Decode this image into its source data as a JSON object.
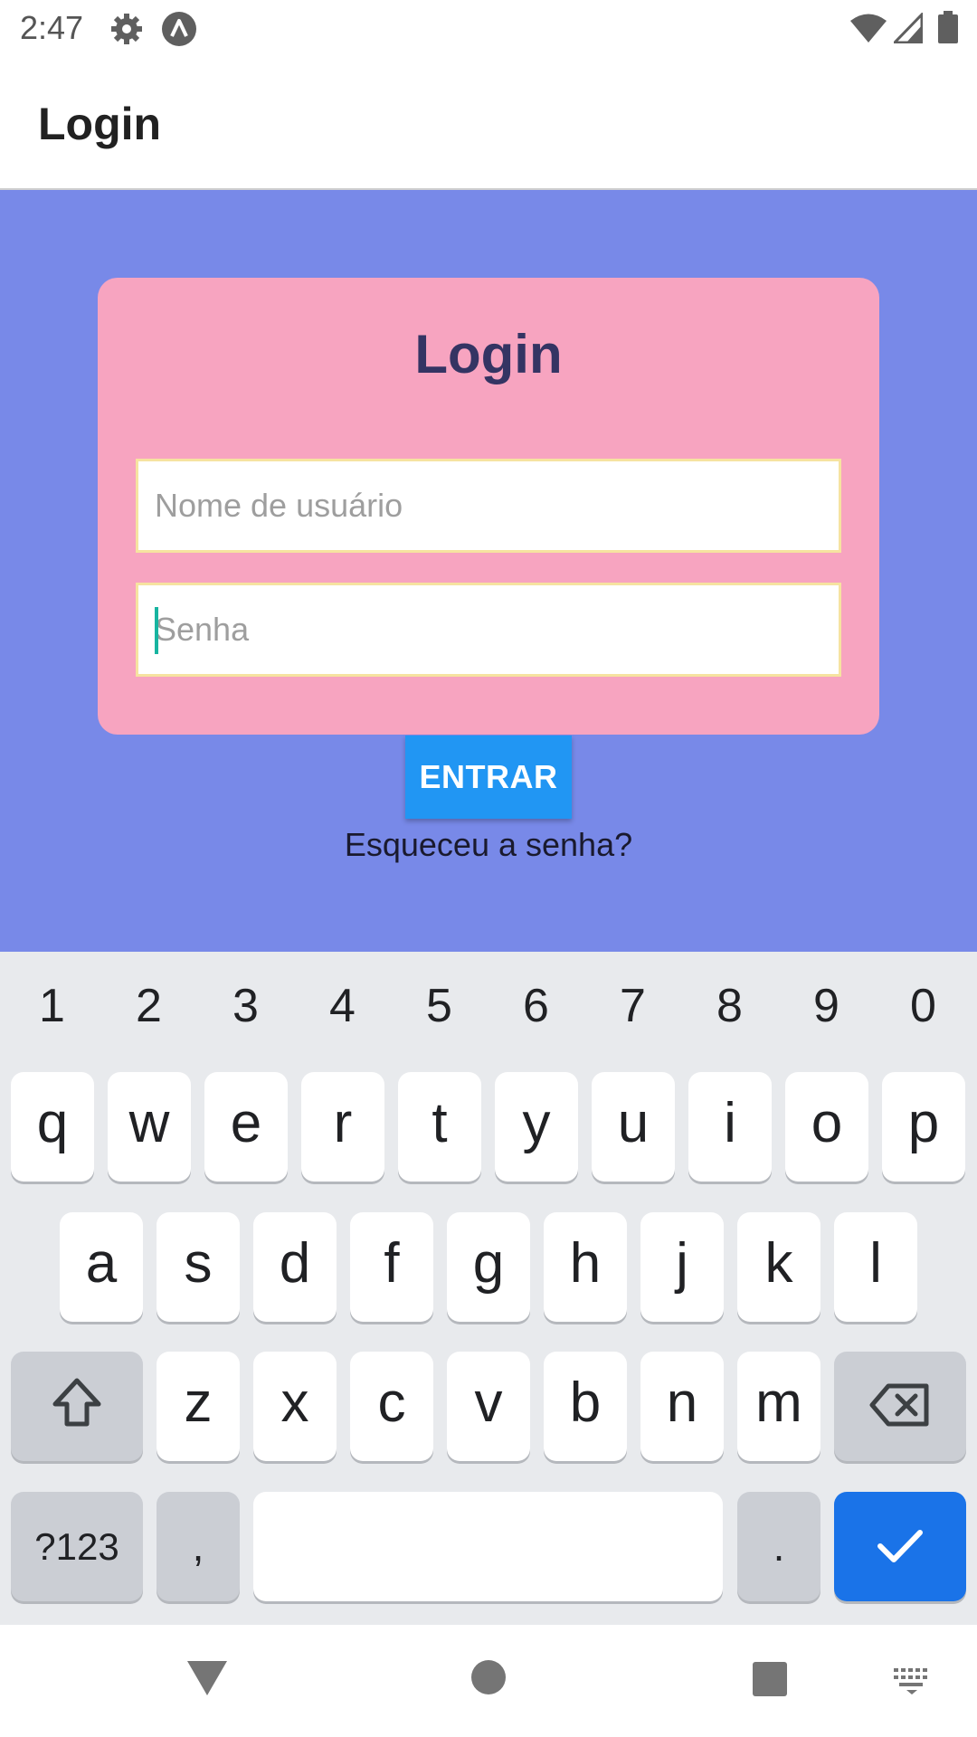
{
  "status_bar": {
    "time": "2:47",
    "icons": [
      "settings-icon",
      "accessibility-icon",
      "wifi-icon",
      "signal-icon",
      "battery-icon"
    ]
  },
  "app_bar": {
    "title": "Login"
  },
  "login_card": {
    "title": "Login",
    "username": {
      "value": "",
      "placeholder": "Nome de usuário"
    },
    "password": {
      "value": "",
      "placeholder": "Senha"
    }
  },
  "entrar_label": "ENTRAR",
  "forgot_label": "Esqueceu a senha?",
  "colors": {
    "background": "#7889e8",
    "card": "#f7a4c0",
    "card_title": "#343463",
    "button": "#2196f3",
    "field_border": "#f6e3a0",
    "keyboard": "#e8eaed",
    "done_key": "#1a73e8"
  },
  "keyboard": {
    "numbers": [
      "1",
      "2",
      "3",
      "4",
      "5",
      "6",
      "7",
      "8",
      "9",
      "0"
    ],
    "row1": [
      "q",
      "w",
      "e",
      "r",
      "t",
      "y",
      "u",
      "i",
      "o",
      "p"
    ],
    "row2": [
      "a",
      "s",
      "d",
      "f",
      "g",
      "h",
      "j",
      "k",
      "l"
    ],
    "row3": [
      "z",
      "x",
      "c",
      "v",
      "b",
      "n",
      "m"
    ],
    "symbols": "?123",
    "comma": ",",
    "period": ".",
    "icons": [
      "shift-icon",
      "backspace-icon",
      "checkmark-icon"
    ]
  },
  "nav_bar": {
    "icons": [
      "back-icon",
      "home-icon",
      "recents-icon",
      "keyboard-switch-icon"
    ]
  }
}
